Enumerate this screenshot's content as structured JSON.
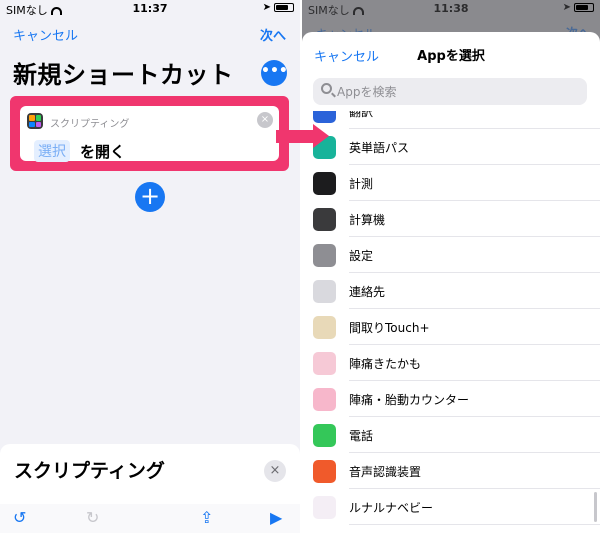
{
  "left": {
    "status": {
      "carrier": "SIMなし",
      "time": "11:37"
    },
    "nav": {
      "cancel": "キャンセル",
      "next": "次へ"
    },
    "title": "新規ショートカット",
    "more_glyph": "•••",
    "action": {
      "category": "スクリプティング",
      "token": "選択",
      "text": "を開く",
      "close_glyph": "×"
    },
    "add_glyph": "+",
    "sheet": {
      "title": "スクリプティング",
      "close_glyph": "×"
    },
    "toolbar": {
      "undo": "↺",
      "redo": "↻",
      "share": "⇪",
      "play": "▶"
    }
  },
  "right": {
    "status": {
      "carrier": "SIMなし",
      "time": "11:38"
    },
    "background_nav": {
      "cancel": "キャンセル",
      "next": "次へ"
    },
    "sheet": {
      "cancel": "キャンセル",
      "title": "Appを選択",
      "search_placeholder": "Appを検索"
    },
    "apps": [
      {
        "label": "翻訳",
        "icon": "translate-icon",
        "color": "#2b63d9"
      },
      {
        "label": "英単語パス",
        "icon": "eitango-pass-icon",
        "color": "#18b39a"
      },
      {
        "label": "計測",
        "icon": "measure-icon",
        "color": "#1c1c1e"
      },
      {
        "label": "計算機",
        "icon": "calculator-icon",
        "color": "#3a3a3c"
      },
      {
        "label": "設定",
        "icon": "settings-icon",
        "color": "#8e8e93"
      },
      {
        "label": "連絡先",
        "icon": "contacts-icon",
        "color": "#d9d9de"
      },
      {
        "label": "間取りTouch+",
        "icon": "madori-icon",
        "color": "#e8d9b8"
      },
      {
        "label": "陣痛きたかも",
        "icon": "jintsu-kitakamo-icon",
        "color": "#f6c9d6"
      },
      {
        "label": "陣痛・胎動カウンター",
        "icon": "jintsu-counter-icon",
        "color": "#f7b7cb"
      },
      {
        "label": "電話",
        "icon": "phone-icon",
        "color": "#34c759"
      },
      {
        "label": "音声認識装置",
        "icon": "voice-recognition-icon",
        "color": "#f05a2b"
      },
      {
        "label": "ルナルナベビー",
        "icon": "lunaluna-baby-icon",
        "color": "#f4eef5"
      }
    ]
  },
  "accent": "#1877f2",
  "highlight": "#f0366e"
}
